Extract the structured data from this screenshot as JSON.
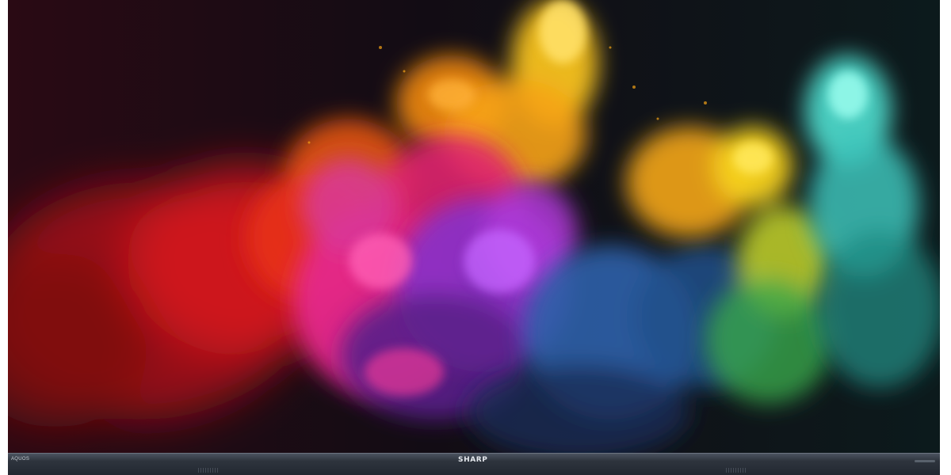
{
  "tv": {
    "brand_logo": "SHARP",
    "model_label": "AQUOS"
  },
  "screen": {
    "subject": "colorful-smoke-explosion",
    "colors": {
      "background_left": "#2a0a14",
      "background_right": "#0c1a1c",
      "red": "#d4141e",
      "orange": "#f07a10",
      "yellow": "#f7c21a",
      "magenta": "#e4288a",
      "purple": "#8a2fc4",
      "blue": "#2c5fa8",
      "green": "#3aa64a",
      "cyan": "#4fe0d0"
    }
  }
}
